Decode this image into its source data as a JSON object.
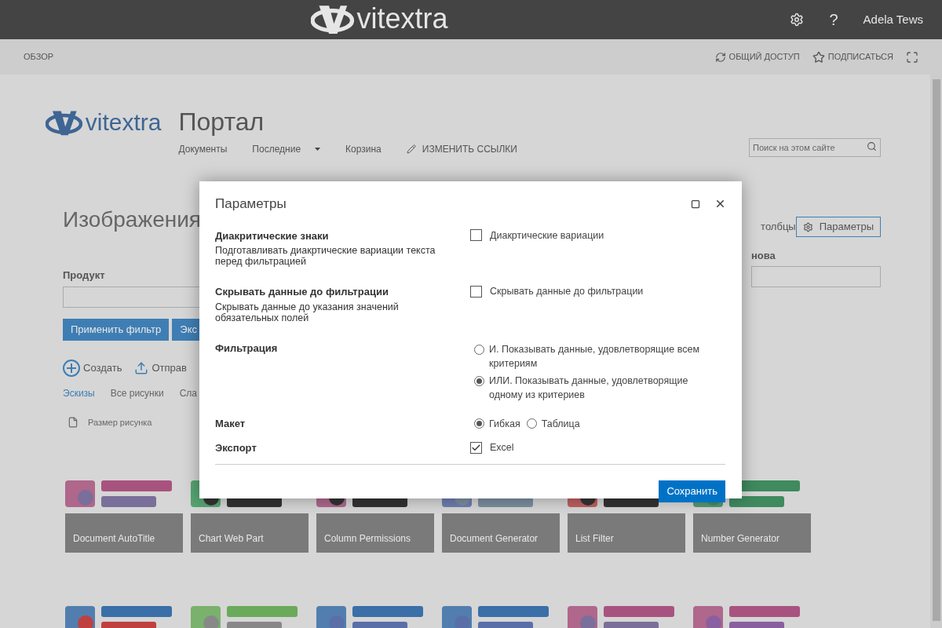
{
  "topbar": {
    "logo": "vitextra",
    "help": "?",
    "user": "Adela Tews"
  },
  "ribbon": {
    "tab": "ОБЗОР",
    "actions": [
      {
        "kind": "share",
        "label": "ОБЩИЙ ДОСТУП"
      },
      {
        "kind": "follow",
        "label": "ПОДПИСАТЬСЯ"
      }
    ]
  },
  "site": {
    "logo": "vitextra",
    "title": "Портал",
    "nav": [
      {
        "kind": "link",
        "label": "Документы"
      },
      {
        "kind": "dropdown",
        "label": "Последние"
      },
      {
        "kind": "link",
        "label": "Корзина"
      },
      {
        "kind": "edit",
        "label": "ИЗМЕНИТЬ ССЫЛКИ"
      }
    ],
    "search": {
      "placeholder": "Поиск на этом сайте"
    }
  },
  "page": {
    "title": "Изображения",
    "filter": {
      "label": "Продукт"
    },
    "buttons": [
      "Применить фильтр",
      "Экс"
    ],
    "commands": [
      {
        "kind": "new",
        "label": "Создать"
      },
      {
        "kind": "upload",
        "label": "Отправ"
      }
    ],
    "views": [
      {
        "label": "Эскизы",
        "selected": true
      },
      {
        "label": "Все рисунки",
        "selected": false
      },
      {
        "label": "Сла",
        "selected": false
      }
    ],
    "column": "Размер рисунка",
    "right_buttons": [
      {
        "label": "толбцы",
        "kind": "plain"
      },
      {
        "label": "Параметры",
        "kind": "settings"
      }
    ],
    "right_label": "нова"
  },
  "tiles": [
    {
      "label": "Document AutoTitle"
    },
    {
      "label": "Chart Web Part"
    },
    {
      "label": "Column Permissions"
    },
    {
      "label": "Document Generator"
    },
    {
      "label": "List Filter"
    },
    {
      "label": "Number Generator"
    }
  ],
  "dialog": {
    "title": "Параметры",
    "rows": [
      {
        "kind": "checkbox",
        "title": "Диакритические знаки",
        "description": "Подготавливать диакртические вариации текста перед фильтрацией",
        "option": {
          "label": "Диакртические вариации",
          "checked": false
        }
      },
      {
        "kind": "checkbox",
        "title": "Скрывать данные до фильтрации",
        "description": "Скрывать данные до указания значений обязательных полей",
        "option": {
          "label": "Скрывать данные до фильтрации",
          "checked": false
        }
      },
      {
        "kind": "radio_stack",
        "title": "Фильтрация",
        "options": [
          {
            "label": "И. Показывать данные, удовлетворящие всем критериям",
            "selected": false
          },
          {
            "label": "ИЛИ. Показывать данные, удовлетворящие одному из критериев",
            "selected": true
          }
        ]
      },
      {
        "kind": "radio_inline",
        "title": "Макет",
        "options": [
          {
            "label": "Гибкая",
            "selected": true
          },
          {
            "label": "Таблица",
            "selected": false
          }
        ]
      },
      {
        "kind": "checkbox",
        "title": "Экспорт",
        "option": {
          "label": "Excel",
          "checked": true
        }
      }
    ],
    "save": "Сохранить"
  }
}
